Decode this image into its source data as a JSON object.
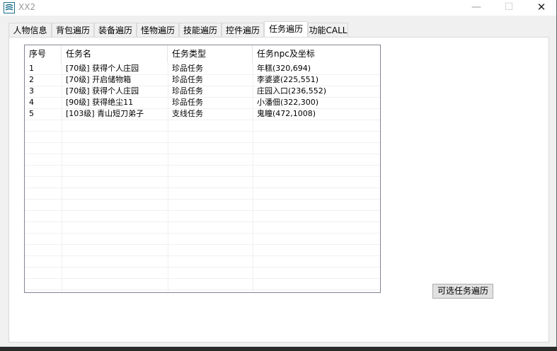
{
  "window": {
    "title": "XX2",
    "minimize": "—",
    "maximize": "☐",
    "close": "✕",
    "icon": "app-logo-icon"
  },
  "tabs": [
    {
      "label": "人物信息",
      "active": false
    },
    {
      "label": "背包遍历",
      "active": false
    },
    {
      "label": "装备遍历",
      "active": false
    },
    {
      "label": "怪物遍历",
      "active": false
    },
    {
      "label": "技能遍历",
      "active": false
    },
    {
      "label": "控件遍历",
      "active": false
    },
    {
      "label": "任务遍历",
      "active": true
    },
    {
      "label": "功能CALL",
      "active": false
    }
  ],
  "task_list": {
    "columns": [
      "序号",
      "任务名",
      "任务类型",
      "任务npc及坐标"
    ],
    "rows": [
      [
        "1",
        "[70级] 获得个人庄园",
        "珍品任务",
        "年糕(320,694)"
      ],
      [
        "2",
        "[70级] 开启储物箱",
        "珍品任务",
        "李婆婆(225,551)"
      ],
      [
        "3",
        "[70级] 获得个人庄园",
        "珍品任务",
        "庄园入口(236,552)"
      ],
      [
        "4",
        "[90级] 获得绝尘11",
        "珍品任务",
        "小潘佃(322,300)"
      ],
      [
        "5",
        "[103级] 青山短刀弟子",
        "支线任务",
        "鬼瞳(472,1008)"
      ]
    ]
  },
  "buttons": {
    "traverse_optional": "可选任务遍历"
  }
}
